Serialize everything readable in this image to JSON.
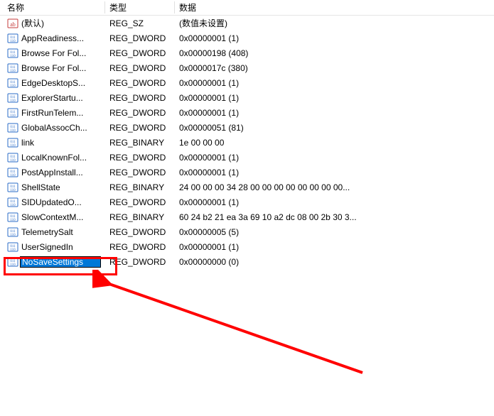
{
  "columns": {
    "name": "名称",
    "type": "类型",
    "data": "数据"
  },
  "icon_kinds": {
    "string": "string-value-icon",
    "binary": "binary-value-icon"
  },
  "values": [
    {
      "icon": "string",
      "name": "(默认)",
      "type": "REG_SZ",
      "data": "(数值未设置)"
    },
    {
      "icon": "binary",
      "name": "AppReadiness...",
      "type": "REG_DWORD",
      "data": "0x00000001 (1)"
    },
    {
      "icon": "binary",
      "name": "Browse For Fol...",
      "type": "REG_DWORD",
      "data": "0x00000198 (408)"
    },
    {
      "icon": "binary",
      "name": "Browse For Fol...",
      "type": "REG_DWORD",
      "data": "0x0000017c (380)"
    },
    {
      "icon": "binary",
      "name": "EdgeDesktopS...",
      "type": "REG_DWORD",
      "data": "0x00000001 (1)"
    },
    {
      "icon": "binary",
      "name": "ExplorerStartu...",
      "type": "REG_DWORD",
      "data": "0x00000001 (1)"
    },
    {
      "icon": "binary",
      "name": "FirstRunTelem...",
      "type": "REG_DWORD",
      "data": "0x00000001 (1)"
    },
    {
      "icon": "binary",
      "name": "GlobalAssocCh...",
      "type": "REG_DWORD",
      "data": "0x00000051 (81)"
    },
    {
      "icon": "binary",
      "name": "link",
      "type": "REG_BINARY",
      "data": "1e 00 00 00"
    },
    {
      "icon": "binary",
      "name": "LocalKnownFol...",
      "type": "REG_DWORD",
      "data": "0x00000001 (1)"
    },
    {
      "icon": "binary",
      "name": "PostAppInstall...",
      "type": "REG_DWORD",
      "data": "0x00000001 (1)"
    },
    {
      "icon": "binary",
      "name": "ShellState",
      "type": "REG_BINARY",
      "data": "24 00 00 00 34 28 00 00 00 00 00 00 00 00..."
    },
    {
      "icon": "binary",
      "name": "SIDUpdatedO...",
      "type": "REG_DWORD",
      "data": "0x00000001 (1)"
    },
    {
      "icon": "binary",
      "name": "SlowContextM...",
      "type": "REG_BINARY",
      "data": "60 24 b2 21 ea 3a 69 10 a2 dc 08 00 2b 30 3..."
    },
    {
      "icon": "binary",
      "name": "TelemetrySalt",
      "type": "REG_DWORD",
      "data": "0x00000005 (5)"
    },
    {
      "icon": "binary",
      "name": "UserSignedIn",
      "type": "REG_DWORD",
      "data": "0x00000001 (1)"
    },
    {
      "icon": "binary",
      "name": "NoSaveSettings",
      "type": "REG_DWORD",
      "data": "0x00000000 (0)",
      "editing": true
    }
  ],
  "annotation": {
    "highlight_target": "NoSaveSettings",
    "color": "#ff0000"
  }
}
